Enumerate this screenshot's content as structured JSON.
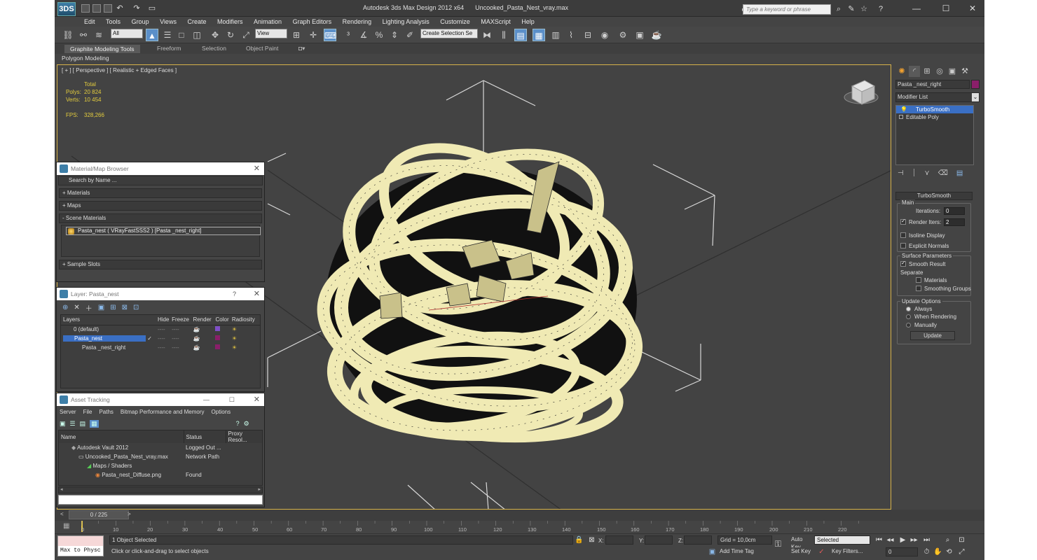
{
  "app": {
    "title": "Autodesk 3ds Max Design 2012 x64",
    "file": "Uncooked_Pasta_Nest_vray.max",
    "logo": "3DS",
    "search_placeholder": "Type a keyword or phrase"
  },
  "menu": [
    "Edit",
    "Tools",
    "Group",
    "Views",
    "Create",
    "Modifiers",
    "Animation",
    "Graph Editors",
    "Rendering",
    "Lighting Analysis",
    "Customize",
    "MAXScript",
    "Help"
  ],
  "toolbar": {
    "selection_filter": "All",
    "reference_coord": "View",
    "named_selection": "Create Selection Se"
  },
  "ribbon": {
    "tabs": [
      "Graphite Modeling Tools",
      "Freeform",
      "Selection",
      "Object Paint"
    ],
    "panel": "Polygon Modeling"
  },
  "viewport": {
    "label": "[ + ] [ Perspective ] [ Realistic + Edged Faces ]",
    "stats_header": "Total",
    "polys_label": "Polys:",
    "polys": "20 824",
    "verts_label": "Verts:",
    "verts": "10 454",
    "fps_label": "FPS:",
    "fps": "328,266",
    "wire_color": "#f0eab4"
  },
  "material_browser": {
    "title": "Material/Map Browser",
    "search": "Search by Name ...",
    "sections": [
      "+ Materials",
      "+ Maps",
      "- Scene Materials"
    ],
    "scene_item": "Pasta_nest  ( VRayFastSSS2 ) [Pasta _nest_right]",
    "footer": "+ Sample Slots"
  },
  "layer_panel": {
    "title": "Layer: Pasta_nest",
    "help": "?",
    "columns": [
      "Layers",
      "Hide",
      "Freeze",
      "Render",
      "Color",
      "Radiosity"
    ],
    "rows": [
      {
        "name": "0 (default)",
        "color": "#7f4fc7"
      },
      {
        "name": "Pasta_nest",
        "color": "#8a1f6a"
      },
      {
        "name": "Pasta _nest_right",
        "color": "#8a1f6a"
      }
    ]
  },
  "asset_tracking": {
    "title": "Asset Tracking",
    "menu": [
      "Server",
      "File",
      "Paths",
      "Bitmap Performance and Memory",
      "Options"
    ],
    "columns": [
      "Name",
      "Status",
      "Proxy Resol..."
    ],
    "rows": [
      {
        "name": "Autodesk Vault 2012",
        "status": "Logged Out ..."
      },
      {
        "name": "Uncooked_Pasta_Nest_vray.max",
        "status": "Network Path"
      },
      {
        "name": "Maps / Shaders",
        "status": ""
      },
      {
        "name": "Pasta_nest_Diffuse.png",
        "status": "Found"
      }
    ]
  },
  "command_panel": {
    "object_name": "Pasta _nest_right",
    "object_color": "#8a1f6a",
    "modifier_list": "Modifier List",
    "stack": [
      "TurboSmooth",
      "Editable Poly"
    ],
    "rollout": "TurboSmooth",
    "main": "Main",
    "iterations_label": "Iterations:",
    "iterations": "0",
    "render_iters_label": "Render Iters:",
    "render_iters": "2",
    "isoline": "Isoline Display",
    "explicit": "Explicit Normals",
    "surface": "Surface Parameters",
    "smooth_result": "Smooth Result",
    "separate": "Separate",
    "materials": "Materials",
    "smoothing_groups": "Smoothing Groups",
    "update_options": "Update Options",
    "always": "Always",
    "when_rendering": "When Rendering",
    "manually": "Manually",
    "update_btn": "Update"
  },
  "timeline": {
    "frame": "0 / 225",
    "ticks": [
      "0",
      "10",
      "20",
      "30",
      "40",
      "50",
      "60",
      "70",
      "80",
      "90",
      "100",
      "110",
      "120",
      "130",
      "140",
      "150",
      "160",
      "170",
      "180",
      "190",
      "200",
      "210",
      "220"
    ]
  },
  "status": {
    "script": "Max to Physc",
    "selected": "1 Object Selected",
    "prompt": "Click or click-and-drag to select objects",
    "x_label": "X:",
    "y_label": "Y:",
    "z_label": "Z:",
    "grid": "Grid = 10,0cm",
    "add_time_tag": "Add Time Tag",
    "auto_key": "Auto Key",
    "set_key": "Set Key",
    "selected_dd": "Selected",
    "key_filters": "Key Filters...",
    "frame_field": "0"
  }
}
